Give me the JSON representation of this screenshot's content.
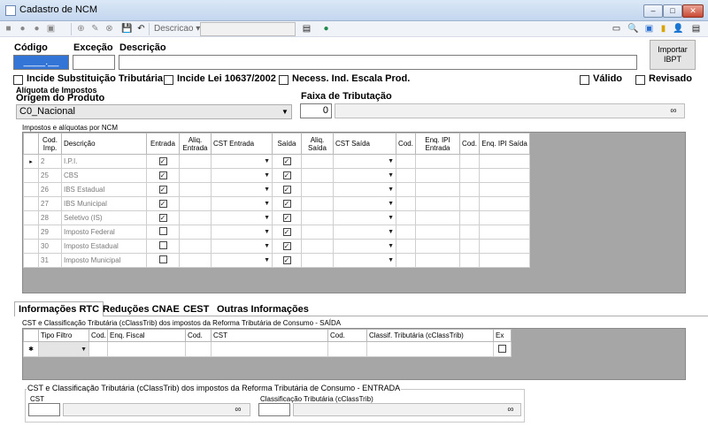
{
  "window": {
    "title": "Cadastro de NCM",
    "min": "–",
    "max": "□",
    "close": "✕"
  },
  "toolbar": {
    "left_icons": [
      "■",
      "●",
      "●",
      "▣",
      "⊕",
      "✎",
      "⊗",
      "💾",
      "↶"
    ],
    "descricao_combo": "Descricao ▾",
    "right_icons": [
      "▭",
      "🔍",
      "▣",
      "▮",
      "👤",
      "▤"
    ]
  },
  "fields": {
    "codigo_label": "Código",
    "codigo_value": "____.__",
    "excecao_label": "Exceção",
    "descricao_label": "Descrição",
    "importar_ibpt": "Importar IBPT"
  },
  "checks": {
    "incide_st": "Incide Substituição Tributária",
    "incide_lei": "Incide Lei 10637/2002",
    "necess_escala": "Necess. Ind. Escala Prod.",
    "valido": "Válido",
    "revisado": "Revisado"
  },
  "aliquota": {
    "group_label": "Alíquota de Impostos",
    "origem_label": "Origem do Produto",
    "origem_value": "C0_Nacional",
    "faixa_label": "Faixa de Tributação",
    "faixa_value": "0",
    "grid_caption": "Impostos e alíquotas por NCM",
    "headers": [
      "Cod. Imp.",
      "Descrição",
      "Entrada",
      "Aliq. Entrada",
      "CST Entrada",
      "Saída",
      "Aliq. Saída",
      "CST Saída",
      "Cod.",
      "Enq. IPI Entrada",
      "Cod.",
      "Enq. IPI Saída"
    ],
    "rows": [
      {
        "cod": "2",
        "desc": "I.P.I.",
        "entrada": true,
        "saida": true
      },
      {
        "cod": "25",
        "desc": "CBS",
        "entrada": true,
        "saida": true
      },
      {
        "cod": "26",
        "desc": "IBS Estadual",
        "entrada": true,
        "saida": true
      },
      {
        "cod": "27",
        "desc": "IBS Municipal",
        "entrada": true,
        "saida": true
      },
      {
        "cod": "28",
        "desc": "Seletivo (IS)",
        "entrada": true,
        "saida": true
      },
      {
        "cod": "29",
        "desc": "Imposto Federal",
        "entrada": false,
        "saida": true
      },
      {
        "cod": "30",
        "desc": "Imposto Estadual",
        "entrada": false,
        "saida": true
      },
      {
        "cod": "31",
        "desc": "Imposto Municipal",
        "entrada": false,
        "saida": true
      }
    ]
  },
  "tabs": [
    "Informações RTC",
    "Reduções CNAE",
    "CEST",
    "Outras Informações"
  ],
  "rtc": {
    "saida_caption": "CST e Classificação Tributária (cClassTrib) dos impostos da Reforma Tributária de Consumo - SAÍDA",
    "saida_headers": [
      "Tipo Filtro",
      "Cod.",
      "Enq. Fiscal",
      "Cod.",
      "CST",
      "Cod.",
      "Classif. Tributária (cClassTrib)",
      "Ex"
    ],
    "entrada_legend": "CST e Classificação Tributária (cClassTrib) dos impostos da Reforma Tributária de Consumo - ENTRADA",
    "cst_label": "CST",
    "class_label": "Classificação Tributária (cClassTrib)"
  }
}
